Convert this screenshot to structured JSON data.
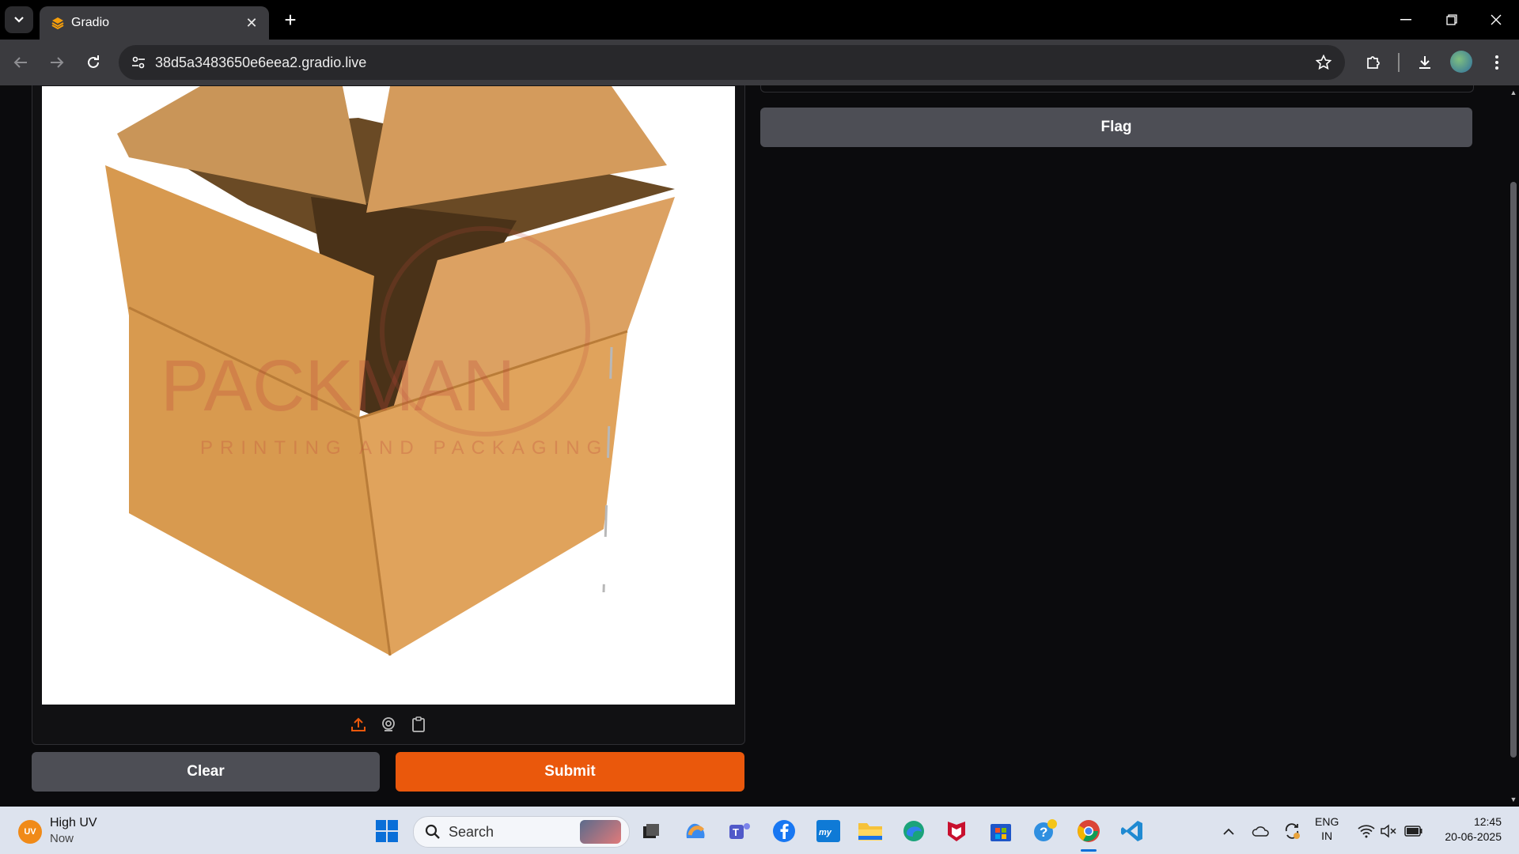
{
  "browser": {
    "tab_title": "Gradio",
    "url": "38d5a3483650e6eea2.gradio.live"
  },
  "app": {
    "image_watermark_main": "PACKMAN",
    "image_watermark_sub": "PRINTING AND PACKAGING",
    "clear_label": "Clear",
    "submit_label": "Submit",
    "flag_label": "Flag",
    "colors": {
      "accent": "#ea580c",
      "secondary_button": "#4d4e55",
      "background": "#0b0b0d"
    }
  },
  "taskbar": {
    "weather_badge": "UV",
    "weather_title": "High UV",
    "weather_subtitle": "Now",
    "search_placeholder": "Search",
    "language_line1": "ENG",
    "language_line2": "IN",
    "time": "12:45",
    "date": "20-06-2025"
  }
}
